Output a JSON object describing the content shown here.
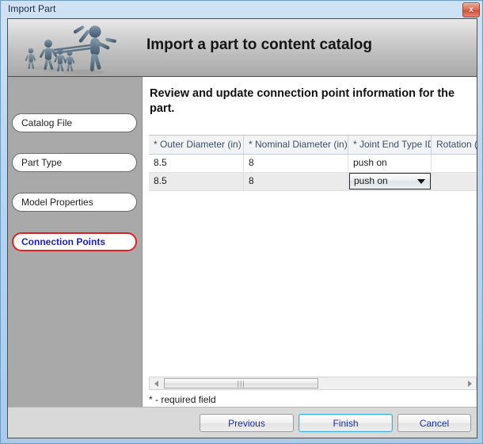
{
  "window": {
    "title": "Import Part",
    "close_label": "x"
  },
  "banner": {
    "title": "Import a part to content catalog",
    "art_name": "running-figures-illustration"
  },
  "sidebar": {
    "items": [
      {
        "label": "Catalog File",
        "active": false
      },
      {
        "label": "Part Type",
        "active": false
      },
      {
        "label": "Model Properties",
        "active": false
      },
      {
        "label": "Connection Points",
        "active": true
      }
    ]
  },
  "content": {
    "heading": "Review and update connection point information for the part.",
    "required_note": "* - required field"
  },
  "grid": {
    "columns": [
      "* Outer Diameter (in)",
      "* Nominal Diameter (in)",
      "* Joint End Type ID",
      "Rotation (°"
    ],
    "rows": [
      {
        "outer_diameter": "8.5",
        "nominal_diameter": "8",
        "joint_end_type": "push on",
        "rotation": "",
        "selected": false,
        "editing": false
      },
      {
        "outer_diameter": "8.5",
        "nominal_diameter": "8",
        "joint_end_type": "push on",
        "rotation": "",
        "selected": true,
        "editing": true
      }
    ],
    "editor": {
      "value": "push on"
    }
  },
  "scrollbar": {
    "left_arrow": "◀",
    "right_arrow": "▶",
    "grip": "|||"
  },
  "footer": {
    "previous_label": "Previous",
    "finish_label": "Finish",
    "cancel_label": "Cancel"
  },
  "colors": {
    "accent_active": "#1c1ccc",
    "accent_active_border": "#e02020",
    "default_button_border": "#3aaedd",
    "header_text": "#3c5068",
    "close_button": "#d4513a"
  }
}
